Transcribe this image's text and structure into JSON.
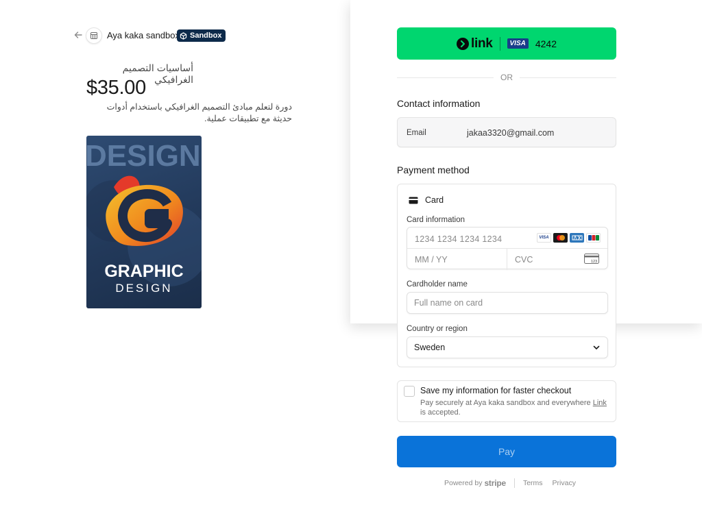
{
  "merchant": {
    "name": "Aya kaka sandbox",
    "badge": "Sandbox"
  },
  "product": {
    "name": "أساسيات التصميم الغرافيكي",
    "price": "$35.00",
    "description": "دورة لتعلم مبادئ التصميم الغرافيكي باستخدام أدوات حديثة مع تطبيقات عملية.",
    "image_text": {
      "top": "DESIGN",
      "line1": "GRAPHIC",
      "line2": "DESIGN"
    }
  },
  "link_button": {
    "logo_text": "link",
    "card_brand": "VISA",
    "last4": "4242"
  },
  "divider_text": "OR",
  "contact": {
    "title": "Contact information",
    "email_label": "Email",
    "email_value": "jakaa3320@gmail.com"
  },
  "payment": {
    "title": "Payment method",
    "method_label": "Card",
    "card_info_label": "Card information",
    "card_number_placeholder": "1234 1234 1234 1234",
    "expiry_placeholder": "MM / YY",
    "cvc_placeholder": "CVC",
    "cardholder_label": "Cardholder name",
    "cardholder_placeholder": "Full name on card",
    "country_label": "Country or region",
    "country_value": "Sweden",
    "brands": [
      "VISA",
      "mastercard",
      "amex",
      "JCB"
    ]
  },
  "save_info": {
    "title": "Save my information for faster checkout",
    "desc_before": "Pay securely at Aya kaka sandbox and everywhere ",
    "desc_link": "Link",
    "desc_after": " is accepted."
  },
  "pay_button": "Pay",
  "footer": {
    "powered_by": "Powered by",
    "brand": "stripe",
    "terms": "Terms",
    "privacy": "Privacy"
  },
  "colors": {
    "link_green": "#00d66f",
    "pay_blue": "#0a73d9",
    "badge_navy": "#0d2a4a"
  }
}
